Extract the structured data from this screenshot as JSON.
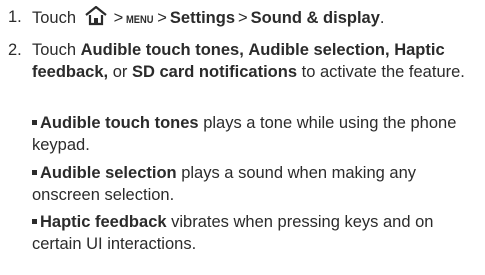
{
  "steps": [
    {
      "num": "1.",
      "touch": "Touch",
      "sep": ">",
      "menu": "MENU",
      "settings": "Settings",
      "sound_display": "Sound & display",
      "period": "."
    },
    {
      "num": "2.",
      "touch": "Touch",
      "item1": "Audible touch tones,",
      "item2": "Audible selection,",
      "item3": "Haptic feedback,",
      "or": "or",
      "item4": "SD card notifications",
      "tail": "to activate the feature."
    }
  ],
  "bullets": [
    {
      "title": "Audible touch tones",
      "desc": "plays a tone while using the phone keypad."
    },
    {
      "title": "Audible selection",
      "desc": "plays a sound when making any onscreen selection."
    },
    {
      "title": "Haptic feedback",
      "desc": "vibrates when pressing keys and on certain UI interactions."
    }
  ]
}
